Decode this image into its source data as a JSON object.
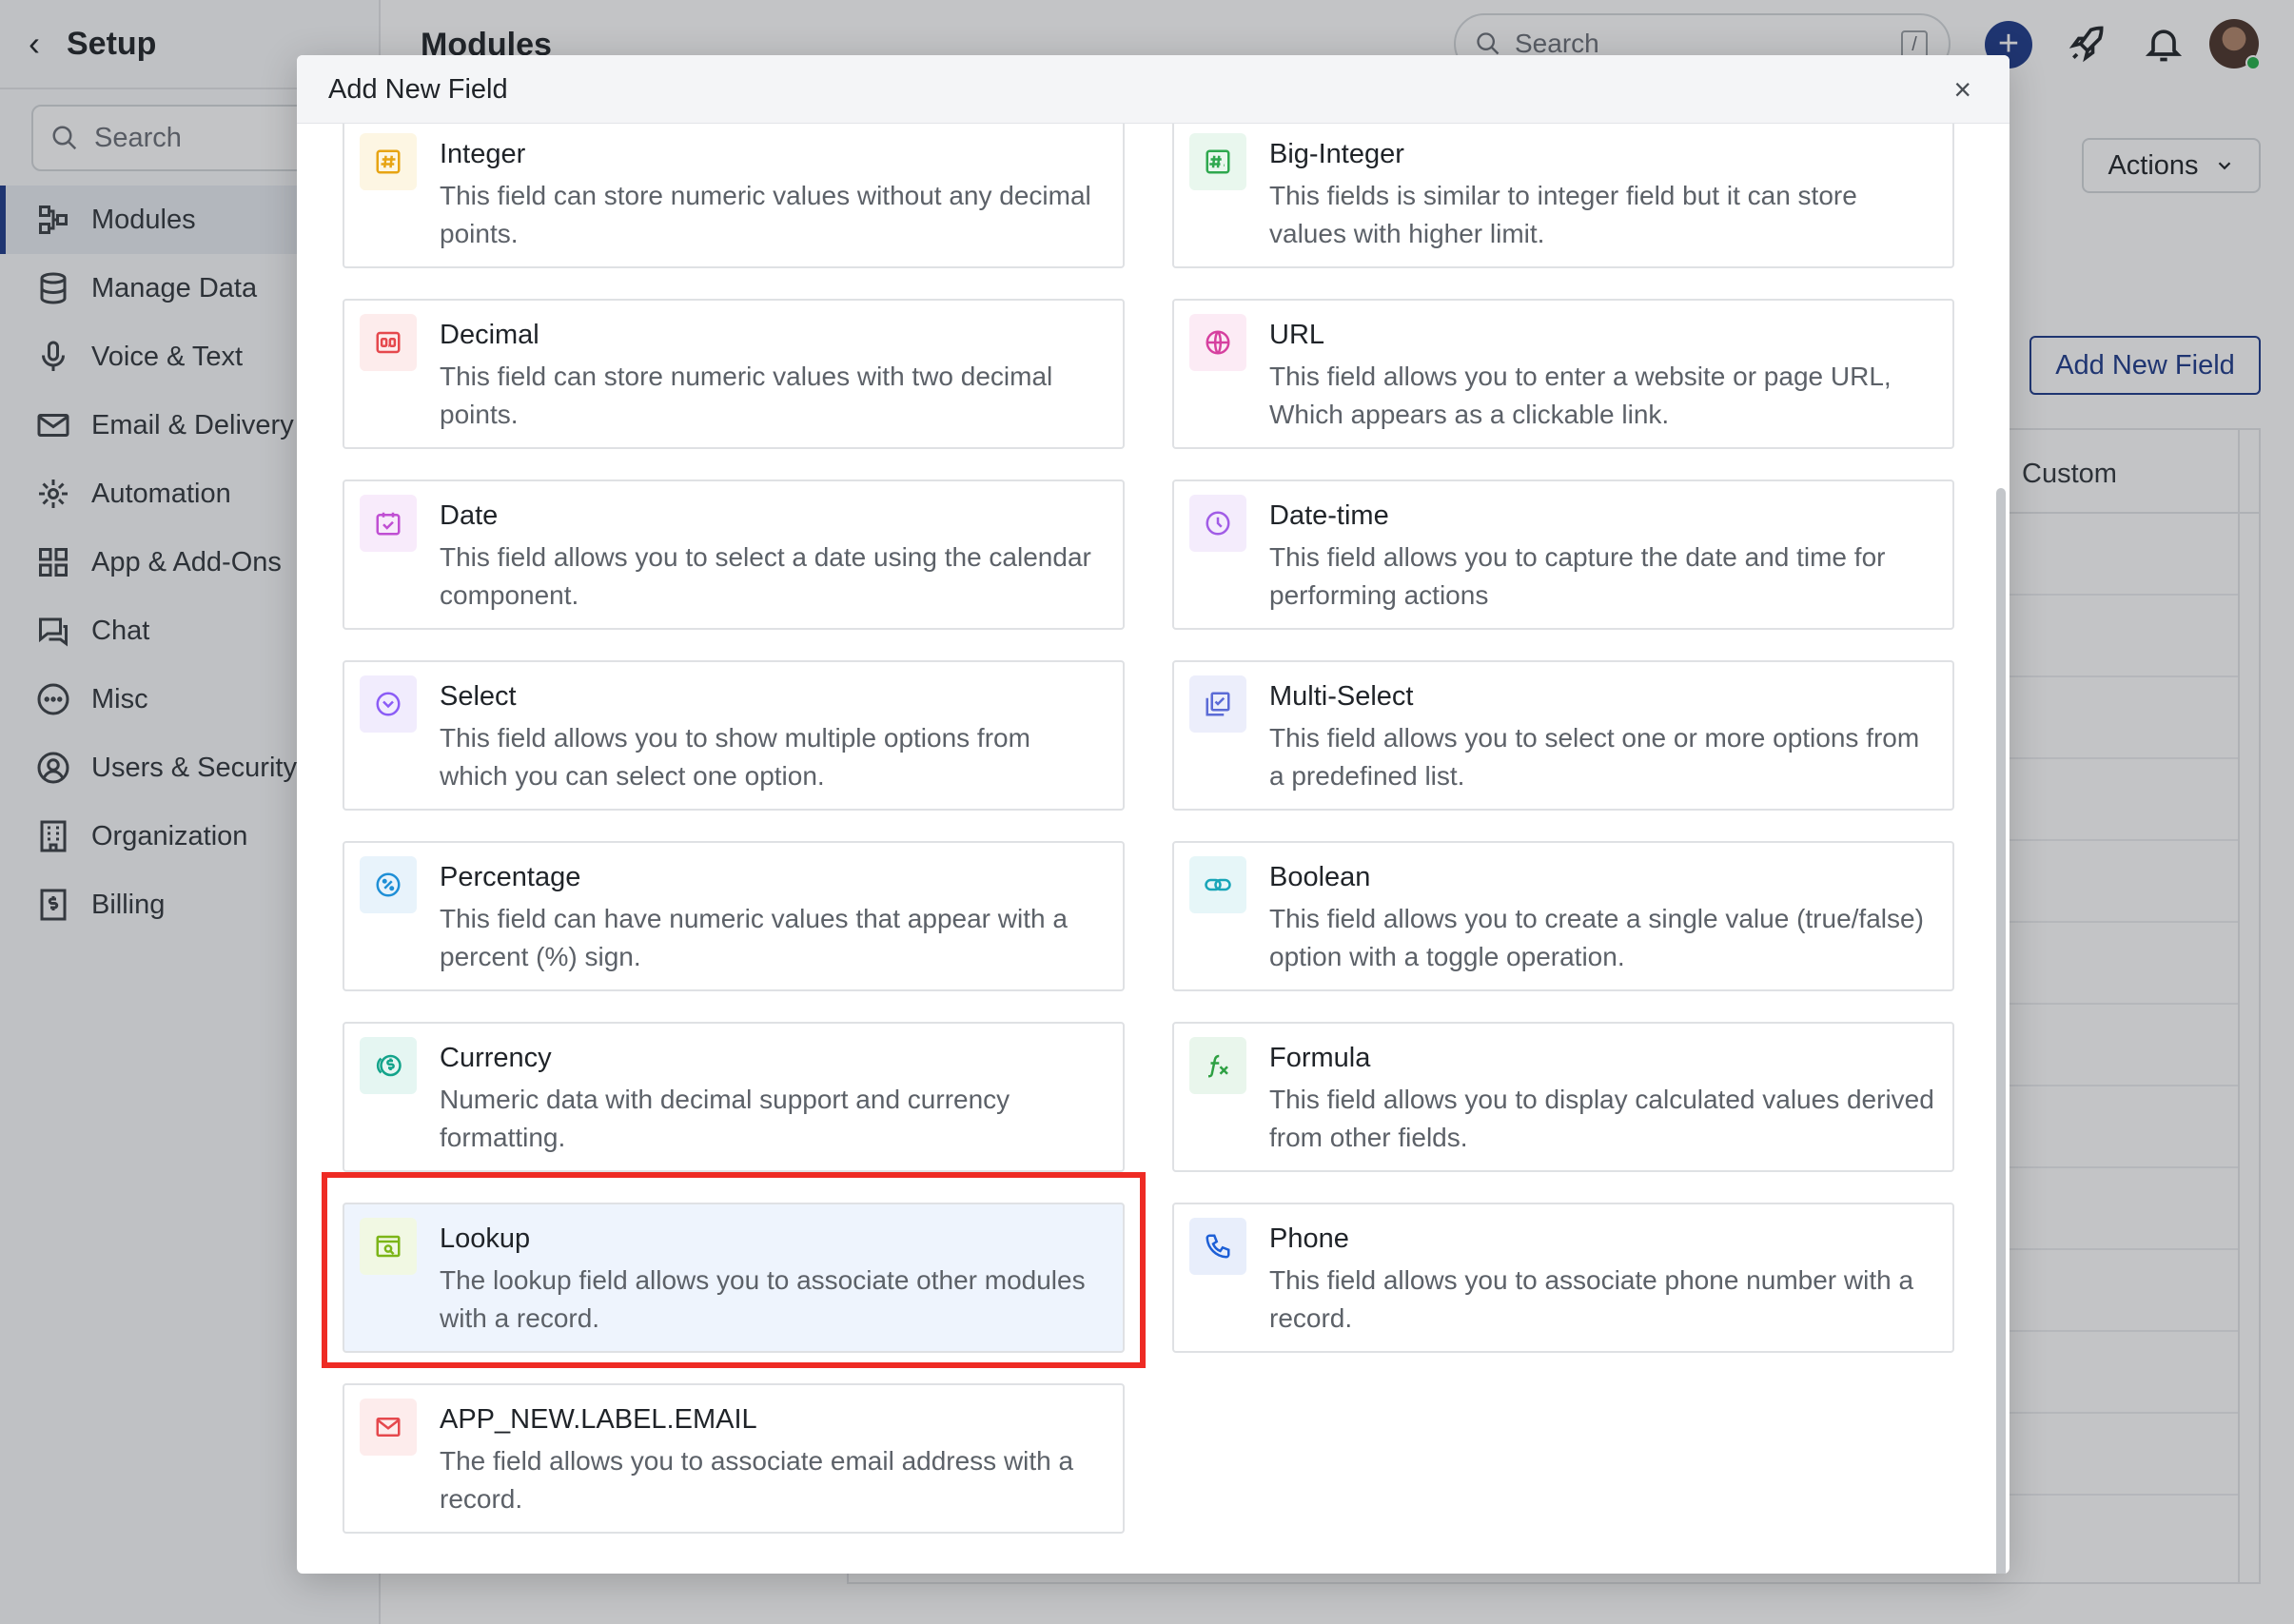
{
  "sidebar": {
    "title": "Setup",
    "search_placeholder": "Search",
    "items": [
      {
        "label": "Modules"
      },
      {
        "label": "Manage Data"
      },
      {
        "label": "Voice & Text"
      },
      {
        "label": "Email & Delivery"
      },
      {
        "label": "Automation"
      },
      {
        "label": "App & Add-Ons"
      },
      {
        "label": "Chat"
      },
      {
        "label": "Misc"
      },
      {
        "label": "Users & Security"
      },
      {
        "label": "Organization"
      },
      {
        "label": "Billing"
      }
    ]
  },
  "header": {
    "page_title": "Modules",
    "search_placeholder": "Search",
    "search_shortcut": "/"
  },
  "main": {
    "actions_label": "Actions",
    "add_new_field_label": "Add New Field",
    "table_header_custom": "Custom"
  },
  "modal": {
    "title": "Add New Field",
    "close": "×",
    "fields": [
      {
        "name": "Integer",
        "desc": "This field can store numeric values without any decimal points.",
        "icon": "hash-icon",
        "color": "#e7a413",
        "bg": "#fdf6e3"
      },
      {
        "name": "Big-Integer",
        "desc": "This fields is similar to integer field but it can store values with higher limit.",
        "icon": "big-hash-icon",
        "color": "#2fa84f",
        "bg": "#e9f7ee"
      },
      {
        "name": "Decimal",
        "desc": "This field can store numeric values with two decimal points.",
        "icon": "decimal-icon",
        "color": "#e5484d",
        "bg": "#fdecec"
      },
      {
        "name": "URL",
        "desc": "This field allows you to enter a website or page URL, Which appears as a clickable link.",
        "icon": "globe-icon",
        "color": "#d6409f",
        "bg": "#fcebf5"
      },
      {
        "name": "Date",
        "desc": "This field allows you to select a date using the calendar component.",
        "icon": "calendar-icon",
        "color": "#c04fd3",
        "bg": "#f8ebfb"
      },
      {
        "name": "Date-time",
        "desc": "This field allows you to capture the date and time for performing actions",
        "icon": "clock-icon",
        "color": "#a15ce6",
        "bg": "#f4ecfc"
      },
      {
        "name": "Select",
        "desc": "This field allows you to show multiple options from which you can select one option.",
        "icon": "chevron-circle-icon",
        "color": "#8b5cf6",
        "bg": "#f1ecfd"
      },
      {
        "name": "Multi-Select",
        "desc": "This field allows you to select one or more options from a predefined list.",
        "icon": "multi-check-icon",
        "color": "#5b6bd6",
        "bg": "#eceefb"
      },
      {
        "name": "Percentage",
        "desc": "This field can have numeric values that appear with a percent (%) sign.",
        "icon": "percent-icon",
        "color": "#1f8fd6",
        "bg": "#e8f3fb"
      },
      {
        "name": "Boolean",
        "desc": "This field allows you to create a single value (true/false) option with a toggle operation.",
        "icon": "toggle-icon",
        "color": "#18a5b8",
        "bg": "#e6f6f8"
      },
      {
        "name": "Currency",
        "desc": "Numeric data with decimal support and currency formatting.",
        "icon": "coins-icon",
        "color": "#12a38a",
        "bg": "#e5f6f2"
      },
      {
        "name": "Formula",
        "desc": "This field allows you to display calculated values derived from other fields.",
        "icon": "function-icon",
        "color": "#2ea043",
        "bg": "#e9f6ec"
      },
      {
        "name": "Lookup",
        "desc": "The lookup field allows you to associate other modules with a record.",
        "icon": "lookup-icon",
        "color": "#7cb518",
        "bg": "#f1f8e3"
      },
      {
        "name": "Phone",
        "desc": "This field allows you to associate phone number with a record.",
        "icon": "phone-icon",
        "color": "#1d5fd6",
        "bg": "#e8eefb"
      },
      {
        "name": "APP_NEW.LABEL.EMAIL",
        "desc": "The field allows you to associate email address with a record.",
        "icon": "mail-icon",
        "color": "#e5484d",
        "bg": "#fdecec"
      }
    ]
  },
  "colors": {
    "accent": "#1d3a8a",
    "highlight": "#ee2b24",
    "selected_card_bg": "#eef4fd"
  }
}
